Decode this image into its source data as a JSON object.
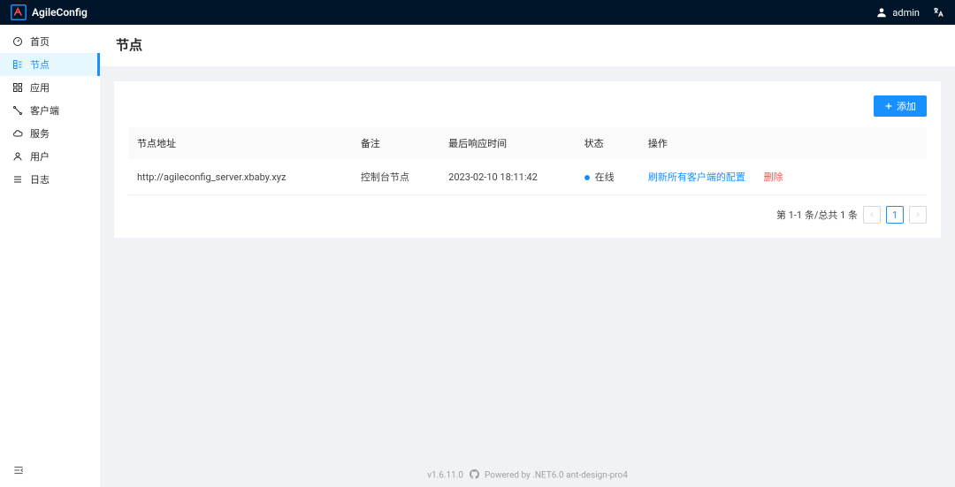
{
  "header": {
    "brand": "AgileConfig",
    "username": "admin"
  },
  "sidebar": {
    "items": [
      {
        "label": "首页"
      },
      {
        "label": "节点"
      },
      {
        "label": "应用"
      },
      {
        "label": "客户端"
      },
      {
        "label": "服务"
      },
      {
        "label": "用户"
      },
      {
        "label": "日志"
      }
    ]
  },
  "page": {
    "title": "节点",
    "add_button": "添加"
  },
  "table": {
    "headers": {
      "address": "节点地址",
      "remark": "备注",
      "last_echo": "最后响应时间",
      "status": "状态",
      "action": "操作"
    },
    "rows": [
      {
        "address": "http://agileconfig_server.xbaby.xyz",
        "remark": "控制台节点",
        "last_echo": "2023-02-10 18:11:42",
        "status": "在线",
        "refresh": "刷新所有客户端的配置",
        "delete": "删除"
      }
    ]
  },
  "pagination": {
    "text": "第 1-1 条/总共 1 条",
    "current": "1"
  },
  "footer": {
    "version": "v1.6.11.0",
    "powered": "Powered by .NET6.0 ant-design-pro4"
  }
}
